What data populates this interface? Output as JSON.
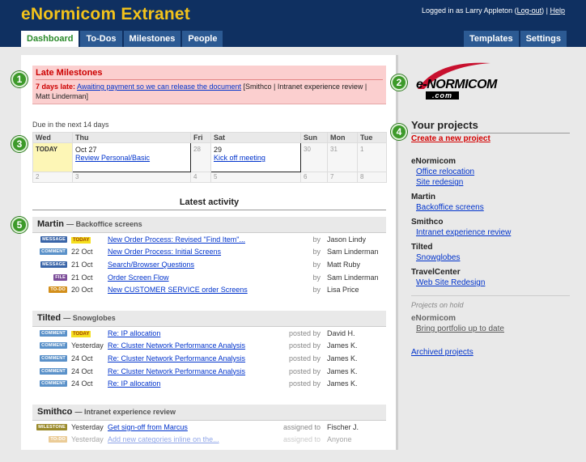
{
  "header": {
    "title": "eNormicom Extranet",
    "logged_in_prefix": "Logged in as Larry Appleton (",
    "logout": "Log-out",
    "logged_in_suffix": ")",
    "separator": " | ",
    "help": "Help"
  },
  "tabs_left": [
    "Dashboard",
    "To-Dos",
    "Milestones",
    "People"
  ],
  "tabs_right": [
    "Templates",
    "Settings"
  ],
  "late": {
    "title": "Late Milestones",
    "days_late": "7 days late:",
    "link": "Awaiting payment so we can release the document",
    "tail": " [Smithco | Intranet experience review | Matt Linderman]"
  },
  "due_label": "Due in the next 14 days",
  "calendar": {
    "days": [
      "Wed",
      "Thu",
      "Fri",
      "Sat",
      "Sun",
      "Mon",
      "Tue"
    ],
    "row1": {
      "today": "TODAY",
      "thu_date": "Oct 27",
      "thu_event": "Review Personal/Basic",
      "fri": "28",
      "sat_date": "29",
      "sat_event": "Kick off meeting",
      "sun": "30",
      "mon": "31",
      "tue": "1"
    },
    "row2": [
      "2",
      "3",
      "4",
      "5",
      "6",
      "7",
      "8"
    ]
  },
  "activity_heading": "Latest activity",
  "groups": [
    {
      "client": "Martin",
      "project": "— Backoffice screens",
      "rows": [
        {
          "type": "MESSAGE",
          "today": "TODAY",
          "date": "",
          "title": "New Order Process: Revised \"Find Item\"...",
          "rel": "by",
          "person": "Jason Lindy"
        },
        {
          "type": "COMMENT",
          "today": "",
          "date": "22 Oct",
          "title": "New Order Process: Initial Screens",
          "rel": "by",
          "person": "Sam Linderman"
        },
        {
          "type": "MESSAGE",
          "today": "",
          "date": "21 Oct",
          "title": "Search/Browser Questions",
          "rel": "by",
          "person": "Matt Ruby"
        },
        {
          "type": "FILE",
          "today": "",
          "date": "21 Oct",
          "title": "Order Screen Flow",
          "rel": "by",
          "person": "Sam Linderman"
        },
        {
          "type": "TO-DO",
          "today": "",
          "date": "20 Oct",
          "title": "New CUSTOMER SERVICE order Screens",
          "rel": "by",
          "person": "Lisa Price"
        }
      ]
    },
    {
      "client": "Tilted",
      "project": "— Snowglobes",
      "rows": [
        {
          "type": "COMMENT",
          "today": "TODAY",
          "date": "",
          "title": "Re: IP allocation",
          "rel": "posted by",
          "person": "David H."
        },
        {
          "type": "COMMENT",
          "today": "",
          "date": "Yesterday",
          "title": "Re: Cluster Network Performance Analysis",
          "rel": "posted by",
          "person": "James K."
        },
        {
          "type": "COMMENT",
          "today": "",
          "date": "24 Oct",
          "title": "Re: Cluster Network Performance Analysis",
          "rel": "posted by",
          "person": "James K."
        },
        {
          "type": "COMMENT",
          "today": "",
          "date": "24 Oct",
          "title": "Re: Cluster Network Performance Analysis",
          "rel": "posted by",
          "person": "James K."
        },
        {
          "type": "COMMENT",
          "today": "",
          "date": "24 Oct",
          "title": "Re: IP allocation",
          "rel": "posted by",
          "person": "James K."
        }
      ]
    },
    {
      "client": "Smithco",
      "project": "— Intranet experience review",
      "rows": [
        {
          "type": "MILESTONE",
          "today": "",
          "date": "Yesterday",
          "title": "Get sign-off from Marcus",
          "rel": "assigned to",
          "person": "Fischer J."
        },
        {
          "type": "TO-DO",
          "today": "",
          "date": "Yesterday",
          "title": "Add new categories inline on the...",
          "rel": "assigned to",
          "person": "Anyone"
        }
      ]
    }
  ],
  "markers": [
    "1",
    "2",
    "3",
    "4",
    "5"
  ],
  "sidebar": {
    "logo_text": "e-NORMICOM",
    "logo_sub": ".com",
    "your_projects": "Your projects",
    "create": "Create a new project",
    "clients": [
      {
        "name": "eNormicom",
        "projects": [
          "Office relocation",
          "Site redesign"
        ]
      },
      {
        "name": "Martin",
        "projects": [
          "Backoffice screens"
        ]
      },
      {
        "name": "Smithco",
        "projects": [
          "Intranet experience review"
        ]
      },
      {
        "name": "Tilted",
        "projects": [
          "Snowglobes"
        ]
      },
      {
        "name": "TravelCenter",
        "projects": [
          "Web Site Redesign"
        ]
      }
    ],
    "on_hold_label": "Projects on hold",
    "on_hold_client": "eNormicom",
    "on_hold_project": "Bring portfolio up to date",
    "archived": "Archived projects"
  },
  "colors": {
    "header_bg": "#0f3061",
    "title_yellow": "#f2c21b",
    "late_red": "#cc0000",
    "marker_green": "#3d9a2a"
  }
}
